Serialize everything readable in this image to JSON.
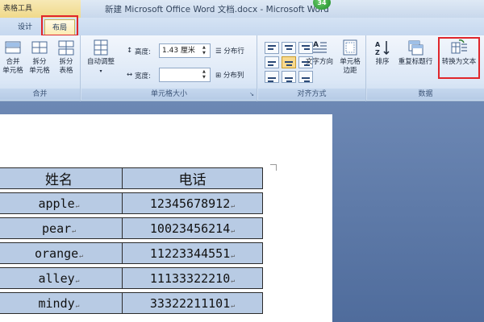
{
  "titlebar": {
    "context_group": "表格工具",
    "doc_title": "新建 Microsoft Office Word 文档.docx - Microsoft Word",
    "badge": "34"
  },
  "tabs": {
    "design": "设计",
    "layout": "布局"
  },
  "ribbon": {
    "merge": {
      "label": "合并",
      "buttons": [
        "合并\n单元格",
        "拆分\n单元格",
        "拆分\n表格"
      ]
    },
    "cell_size": {
      "label": "单元格大小",
      "autofit": "自动调整",
      "height_label": "高度:",
      "height_value": "1.43 厘米",
      "width_label": "宽度:",
      "width_value": "",
      "distribute_rows": "分布行",
      "distribute_cols": "分布列"
    },
    "alignment": {
      "label": "对齐方式",
      "text_direction": "文字方向",
      "cell_margins": "单元格\n边距"
    },
    "data": {
      "label": "数据",
      "sort": "排序",
      "repeat_header": "重复标题行",
      "convert_to_text": "转换为文本"
    }
  },
  "table": {
    "header": [
      "姓名",
      "电话"
    ],
    "rows": [
      [
        "apple",
        "12345678912"
      ],
      [
        "pear",
        "10023456214"
      ],
      [
        "orange",
        "11223344551"
      ],
      [
        "alley",
        "11133322210"
      ],
      [
        "mindy",
        "33322211101"
      ]
    ]
  },
  "colors": {
    "accent_highlight": "#e0262b",
    "table_fill": "#b8cbe4",
    "context_tab": "#f0d98a"
  }
}
